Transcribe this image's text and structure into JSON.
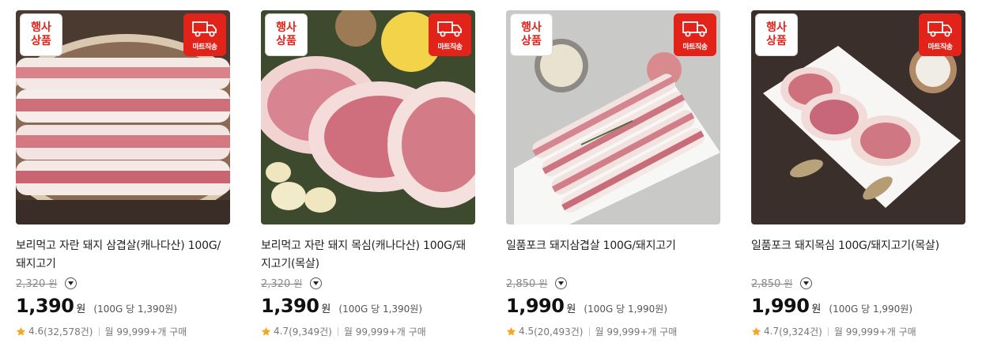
{
  "products": [
    {
      "promo_label": "행사\n상품",
      "delivery_label": "마트직송",
      "delivery_icon": "truck-icon",
      "name": "보리먹고 자란 돼지 삼겹살(캐나다산) 100G/돼지고기",
      "original_price": "2,320",
      "original_won": "원",
      "price": "1,390",
      "price_won": "원",
      "unit_price": "(100G 당 1,390원)",
      "rating": "4.6",
      "reviews": "(32,578건)",
      "monthly": "월 99,999+개 구매"
    },
    {
      "promo_label": "행사\n상품",
      "delivery_label": "마트직송",
      "delivery_icon": "truck-icon",
      "name": "보리먹고 자란 돼지 목심(캐나다산) 100G/돼지고기(목살)",
      "original_price": "2,320",
      "original_won": "원",
      "price": "1,390",
      "price_won": "원",
      "unit_price": "(100G 당 1,390원)",
      "rating": "4.7",
      "reviews": "(9,349건)",
      "monthly": "월 99,999+개 구매"
    },
    {
      "promo_label": "행사\n상품",
      "delivery_label": "마트직송",
      "delivery_icon": "truck-icon",
      "name": "일품포크 돼지삼겹살 100G/돼지고기",
      "original_price": "2,850",
      "original_won": "원",
      "price": "1,990",
      "price_won": "원",
      "unit_price": "(100G 당 1,990원)",
      "rating": "4.5",
      "reviews": "(20,493건)",
      "monthly": "월 99,999+개 구매"
    },
    {
      "promo_label": "행사\n상품",
      "delivery_label": "마트직송",
      "delivery_icon": "truck-icon",
      "name": "일품포크 돼지목심 100G/돼지고기(목살)",
      "original_price": "2,850",
      "original_won": "원",
      "price": "1,990",
      "price_won": "원",
      "unit_price": "(100G 당 1,990원)",
      "rating": "4.7",
      "reviews": "(9,324건)",
      "monthly": "월 99,999+개 구매"
    }
  ],
  "colors": {
    "promo_red": "#e2231a",
    "star_yellow": "#f5a623",
    "strike_gray": "#8a8a8a"
  }
}
